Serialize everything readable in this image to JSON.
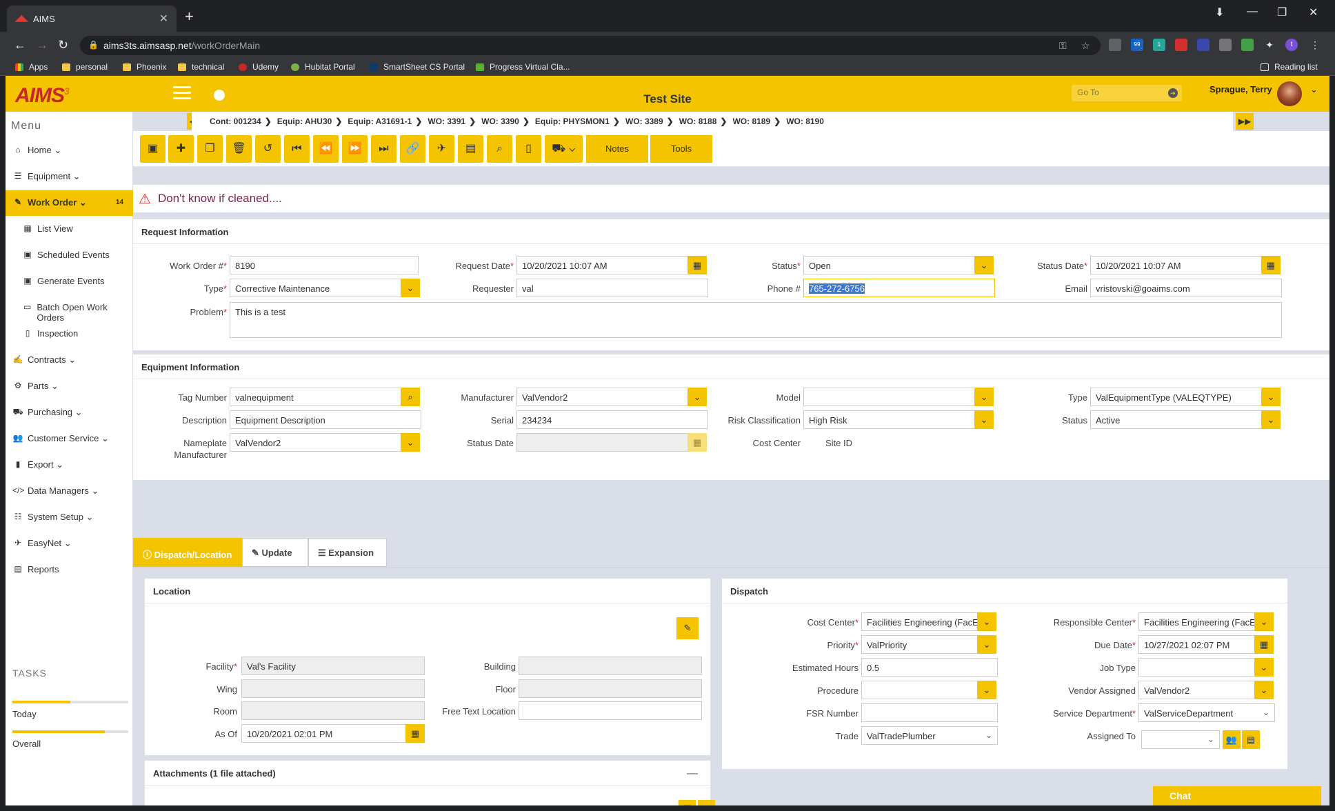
{
  "browser": {
    "tab_title": "AIMS",
    "url_host": "aims3ts.aimsasp.net",
    "url_path": "/workOrderMain",
    "bookmarks": [
      "Apps",
      "personal",
      "Phoenix",
      "technical",
      "Udemy",
      "Hubitat Portal",
      "SmartSheet CS Portal",
      "Progress Virtual Cla..."
    ],
    "reading_list": "Reading list",
    "ext_badge_1": "99",
    "ext_badge_2": "1",
    "profile_initial": "t"
  },
  "header": {
    "logo": "AIMS",
    "logo_sup": "3",
    "site_title": "Test Site",
    "goto_placeholder": "Go To",
    "user_name": "Sprague, Terry"
  },
  "sidebar": {
    "menu_title": "Menu",
    "items": [
      {
        "label": "Home",
        "icon": "home-icon"
      },
      {
        "label": "Equipment",
        "icon": "list-icon"
      },
      {
        "label": "Work Order",
        "icon": "edit-icon",
        "badge": "14"
      },
      {
        "label": "List View",
        "icon": "table-icon"
      },
      {
        "label": "Scheduled Events",
        "icon": "calendar-icon"
      },
      {
        "label": "Generate Events",
        "icon": "calendar-icon"
      },
      {
        "label": "Batch Open Work Orders",
        "icon": "folder-open-icon"
      },
      {
        "label": "Inspection",
        "icon": "document-icon"
      },
      {
        "label": "Contracts",
        "icon": "signature-icon"
      },
      {
        "label": "Parts",
        "icon": "cogs-icon"
      },
      {
        "label": "Purchasing",
        "icon": "cart-icon"
      },
      {
        "label": "Customer Service",
        "icon": "users-icon"
      },
      {
        "label": "Export",
        "icon": "book-icon"
      },
      {
        "label": "Data Managers",
        "icon": "code-icon"
      },
      {
        "label": "System Setup",
        "icon": "sliders-icon"
      },
      {
        "label": "EasyNet",
        "icon": "paper-plane-icon"
      },
      {
        "label": "Reports",
        "icon": "report-icon"
      }
    ],
    "tasks_title": "TASKS",
    "today_label": "Today",
    "today_progress": 0.5,
    "overall_label": "Overall",
    "overall_progress": 0.8
  },
  "breadcrumb": [
    "Cont: 001234",
    "Equip: AHU30",
    "Equip: A31691-1",
    "WO: 3391",
    "WO: 3390",
    "Equip: PHYSMON1",
    "WO: 3389",
    "WO: 8188",
    "WO: 8189",
    "WO: 8190"
  ],
  "toolbar": {
    "notes_label": "Notes",
    "tools_label": "Tools"
  },
  "alert": "Don't know if cleaned....",
  "request": {
    "title": "Request Information",
    "work_order_label": "Work Order #",
    "work_order": "8190",
    "request_date_label": "Request Date",
    "request_date": "10/20/2021 10:07 AM",
    "status_label": "Status",
    "status": "Open",
    "status_date_label": "Status Date",
    "status_date": "10/20/2021 10:07 AM",
    "type_label": "Type",
    "type": "Corrective Maintenance",
    "requester_label": "Requester",
    "requester": "val",
    "phone_label": "Phone #",
    "phone": "765-272-6756",
    "email_label": "Email",
    "email": "vristovski@goaims.com",
    "problem_label": "Problem",
    "problem": "This is a test"
  },
  "equipment": {
    "title": "Equipment Information",
    "tag_label": "Tag Number",
    "tag": "valnequipment",
    "manufacturer_label": "Manufacturer",
    "manufacturer": "ValVendor2",
    "model_label": "Model",
    "model": "",
    "type_label": "Type",
    "type": "ValEquipmentType (VALEQTYPE)",
    "description_label": "Description",
    "description": "Equipment Description",
    "serial_label": "Serial",
    "serial": "234234",
    "risk_label": "Risk Classification",
    "risk": "High Risk",
    "status_label": "Status",
    "status": "Active",
    "nameplate_label_1": "Nameplate",
    "nameplate_label_2": "Manufacturer",
    "nameplate": "ValVendor2",
    "status_date_label": "Status Date",
    "cost_center_label": "Cost Center",
    "site_id_label": "Site ID"
  },
  "tabs": {
    "dispatch": "Dispatch/Location",
    "update": "Update",
    "expansion": "Expansion"
  },
  "location": {
    "title": "Location",
    "facility_label": "Facility",
    "facility": "Val's Facility",
    "building_label": "Building",
    "wing_label": "Wing",
    "floor_label": "Floor",
    "room_label": "Room",
    "free_text_label": "Free Text Location",
    "as_of_label": "As Of",
    "as_of": "10/20/2021 02:01 PM"
  },
  "attachments": {
    "title": "Attachments (1 file attached)"
  },
  "dispatch": {
    "title": "Dispatch",
    "cost_center_label": "Cost Center",
    "cost_center": "Facilities Engineering (FacE",
    "responsible_label": "Responsible Center",
    "responsible": "Facilities Engineering (FacE",
    "priority_label": "Priority",
    "priority": "ValPriority",
    "due_date_label": "Due Date",
    "due_date": "10/27/2021 02:07 PM",
    "est_hours_label": "Estimated Hours",
    "est_hours": "0.5",
    "job_type_label": "Job Type",
    "procedure_label": "Procedure",
    "vendor_label": "Vendor Assigned",
    "vendor": "ValVendor2",
    "fsr_label": "FSR Number",
    "service_dept_label": "Service Department",
    "service_dept": "ValServiceDepartment",
    "trade_label": "Trade",
    "trade": "ValTradePlumber",
    "assigned_label": "Assigned To"
  },
  "chat_label": "Chat"
}
